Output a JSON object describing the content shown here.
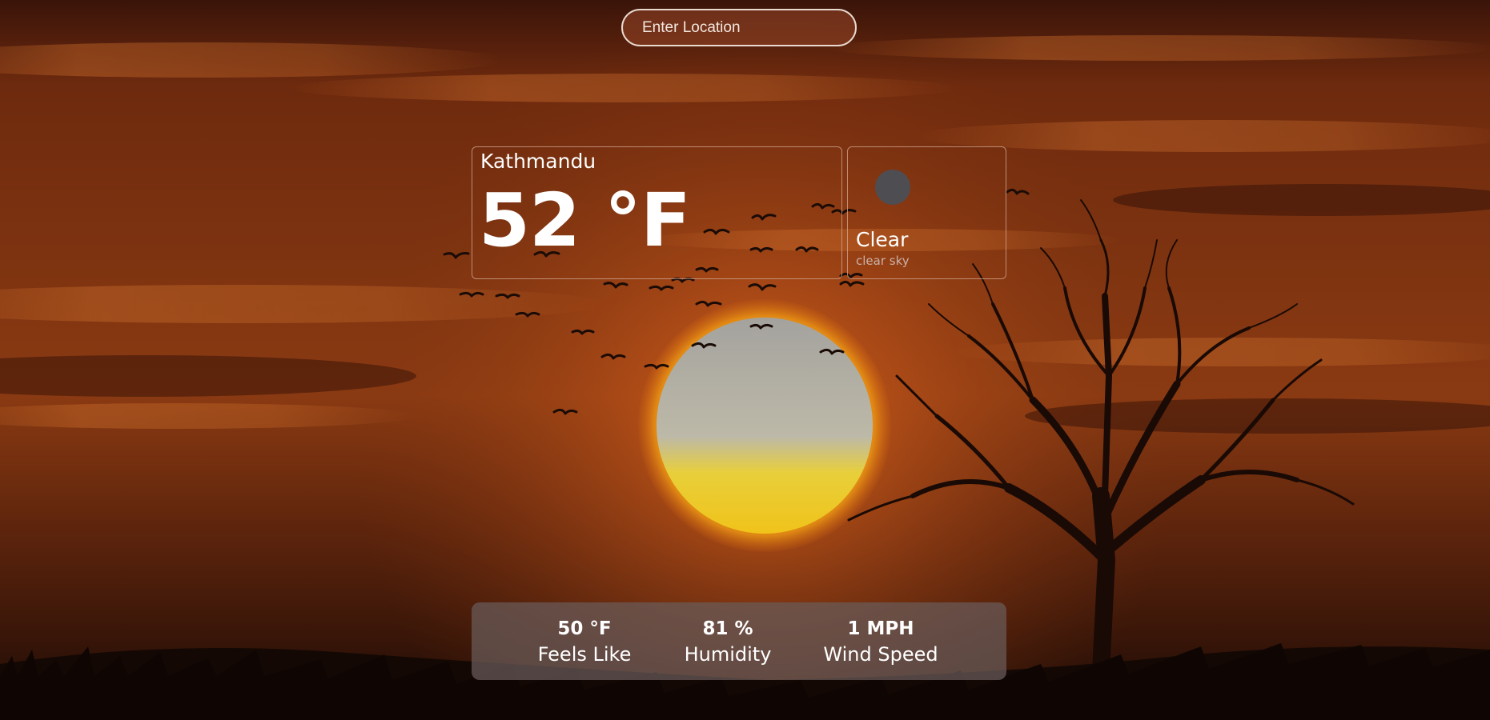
{
  "search": {
    "placeholder": "Enter Location",
    "value": ""
  },
  "current": {
    "city": "Kathmandu",
    "temperature": "52 °F",
    "condition": "Clear",
    "description": "clear sky",
    "icon": "weather-icon"
  },
  "stats": {
    "feels_like": {
      "value": "50 °F",
      "label": "Feels Like"
    },
    "humidity": {
      "value": "81 %",
      "label": "Humidity"
    },
    "wind_speed": {
      "value": "1 MPH",
      "label": "Wind Speed"
    }
  },
  "colors": {
    "sky_dark": "#2a1008",
    "sky_orange": "#b8521b",
    "sun_core": "#b4b2a8",
    "sun_glow": "#f2c41e",
    "card_border": "#d2aa96",
    "stats_panel": "#695c5a",
    "icon_placeholder": "#4e4d52"
  },
  "background": {
    "scene": "sunset with sun, flying birds, bare tree silhouette and grass"
  }
}
